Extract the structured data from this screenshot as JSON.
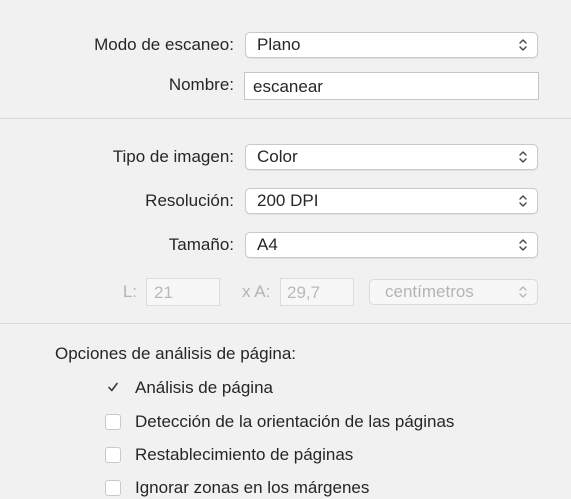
{
  "scan": {
    "mode_label": "Modo de escaneo:",
    "mode_value": "Plano",
    "name_label": "Nombre:",
    "name_value": "escanear"
  },
  "image": {
    "type_label": "Tipo de imagen:",
    "type_value": "Color",
    "resolution_label": "Resolución:",
    "resolution_value": "200 DPI",
    "size_label": "Tamaño:",
    "size_value": "A4",
    "width_label": "L:",
    "width_value": "21",
    "height_label": "x A:",
    "height_value": "29,7",
    "units_value": "centímetros"
  },
  "analysis": {
    "heading": "Opciones de análisis de página:",
    "options": [
      {
        "label": "Análisis de página",
        "checked": true
      },
      {
        "label": "Detección de la orientación de las páginas",
        "checked": false
      },
      {
        "label": "Restablecimiento de páginas",
        "checked": false
      },
      {
        "label": "Ignorar zonas en los márgenes",
        "checked": false
      }
    ]
  },
  "icons": {
    "popup_arrow": "chevron-up-down-icon",
    "check_mark": "checkmark-icon"
  }
}
